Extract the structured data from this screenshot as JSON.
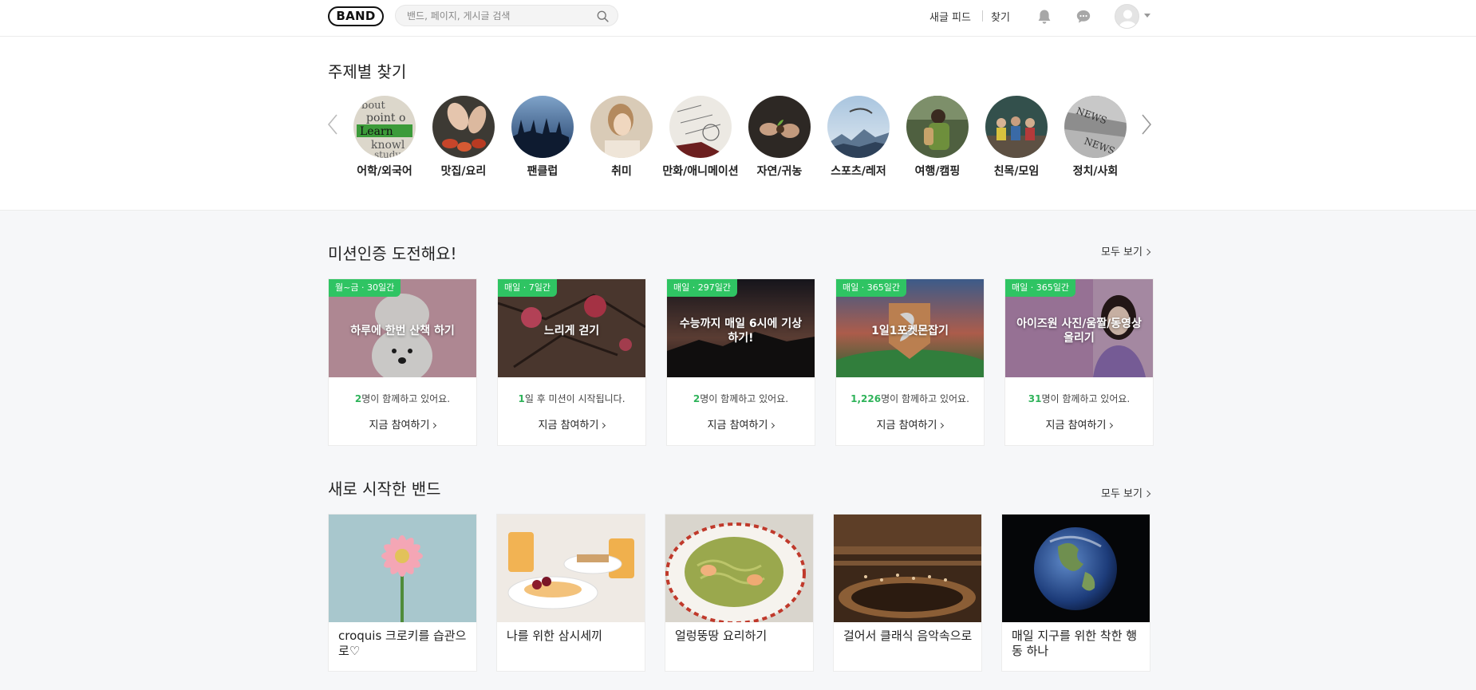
{
  "header": {
    "logo": "BAND",
    "search_placeholder": "밴드, 페이지, 게시글 검색",
    "nav": {
      "new_feed": "새글 피드",
      "find": "찾기"
    }
  },
  "topics": {
    "title": "주제별 찾기",
    "items": [
      {
        "label": "어학/외국어"
      },
      {
        "label": "맛집/요리"
      },
      {
        "label": "팬클럽"
      },
      {
        "label": "취미"
      },
      {
        "label": "만화/애니메이션"
      },
      {
        "label": "자연/귀농"
      },
      {
        "label": "스포츠/레저"
      },
      {
        "label": "여행/캠핑"
      },
      {
        "label": "친목/모임"
      },
      {
        "label": "정치/사회"
      }
    ]
  },
  "missions": {
    "title": "미션인증 도전해요!",
    "see_all": "모두 보기",
    "join_label": "지금 참여하기",
    "items": [
      {
        "badge": "월~금 · 30일간",
        "title": "하루에 한번 산책 하기",
        "count": "2",
        "status": "명이 함께하고 있어요."
      },
      {
        "badge": "매일 · 7일간",
        "title": "느리게 걷기",
        "count": "1",
        "status": "일 후 미션이 시작됩니다."
      },
      {
        "badge": "매일 · 297일간",
        "title": "수능까지 매일 6시에 기상하기!",
        "count": "2",
        "status": "명이 함께하고 있어요."
      },
      {
        "badge": "매일 · 365일간",
        "title": "1일1포켓몬잡기",
        "count": "1,226",
        "status": "명이 함께하고 있어요."
      },
      {
        "badge": "매일 · 365일간",
        "title": "아이즈원 사진/움짤/동영상 올리기",
        "count": "31",
        "status": "명이 함께하고 있어요."
      }
    ]
  },
  "new_bands": {
    "title": "새로 시작한 밴드",
    "see_all": "모두 보기",
    "items": [
      {
        "name": "croquis 크로키를 습관으로♡"
      },
      {
        "name": "나를 위한 삼시세끼"
      },
      {
        "name": "얼렁뚱땅 요리하기"
      },
      {
        "name": "걸어서 클래식 음악속으로"
      },
      {
        "name": "매일 지구를 위한 착한 행동 하나"
      }
    ]
  },
  "colors": {
    "accent_green": "#2fc463",
    "count_green": "#2fb35a"
  }
}
